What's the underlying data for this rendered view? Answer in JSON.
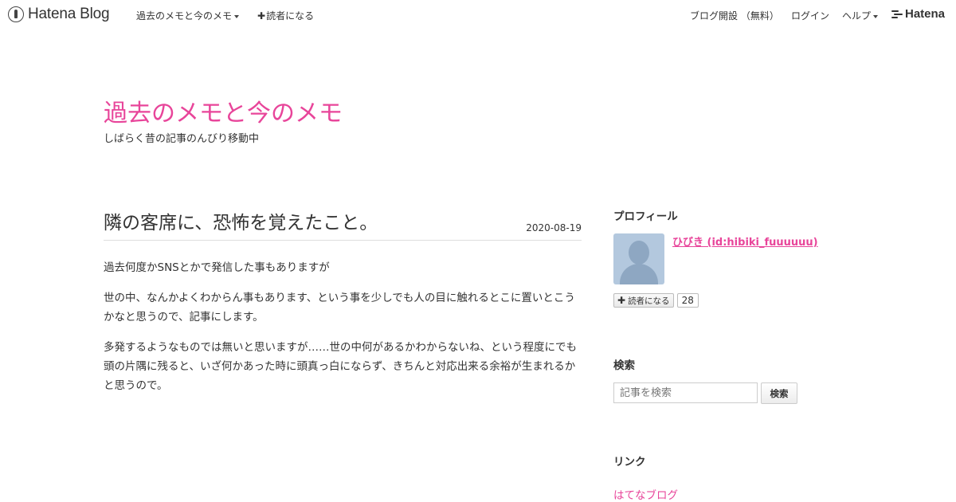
{
  "topbar": {
    "logo_text": "Hatena Blog",
    "blog_menu_label": "過去のメモと今のメモ",
    "subscribe_label": "読者になる",
    "open_blog_label": "ブログ開設 （無料）",
    "login_label": "ログイン",
    "help_label": "ヘルプ",
    "brand_text": "Hatena"
  },
  "header": {
    "title": "過去のメモと今のメモ",
    "description": "しばらく昔の記事のんびり移動中"
  },
  "article": {
    "title": "隣の客席に、恐怖を覚えたこと。",
    "date": "2020-08-19",
    "paragraphs": [
      "過去何度かSNSとかで発信した事もありますが",
      "世の中、なんかよくわからん事もあります、という事を少しでも人の目に触れるとこに置いとこうかなと思うので、記事にします。",
      "多発するようなものでは無いと思いますが……世の中何があるかわからないね、という程度にでも頭の片隅に残ると、いざ何かあった時に頭真っ白にならず、きちんと対応出来る余裕が生まれるかと思うので。"
    ]
  },
  "sidebar": {
    "profile_title": "プロフィール",
    "profile_name": "ひびき (id:hibiki_fuuuuuu)",
    "follow_label": "読者になる",
    "follow_count": "28",
    "search_title": "検索",
    "search_placeholder": "記事を検索",
    "search_button": "検索",
    "links_title": "リンク",
    "links": [
      "はてなブログ"
    ]
  },
  "colors": {
    "accent": "#e8459a",
    "text": "#333333",
    "divider": "#dddddd"
  }
}
